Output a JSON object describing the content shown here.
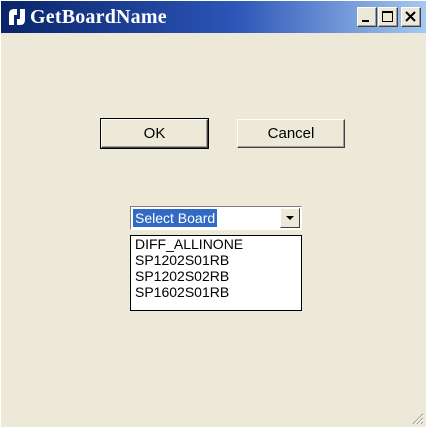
{
  "window": {
    "title": "GetBoardName",
    "icon": "ni-logo-icon",
    "controls": [
      "minimize-icon",
      "maximize-icon",
      "close-icon"
    ]
  },
  "buttons": {
    "ok_label": "OK",
    "cancel_label": "Cancel"
  },
  "board_select": {
    "selected": "Select Board",
    "options": [
      "DIFF_ALLINONE",
      "SP1202S01RB",
      "SP1202S02RB",
      "SP1602S01RB"
    ]
  },
  "colors": {
    "titlebar_start": "#0a246a",
    "titlebar_end": "#a6caf0",
    "dialog_background": "#ece9d8",
    "selection": "#316ac5"
  }
}
